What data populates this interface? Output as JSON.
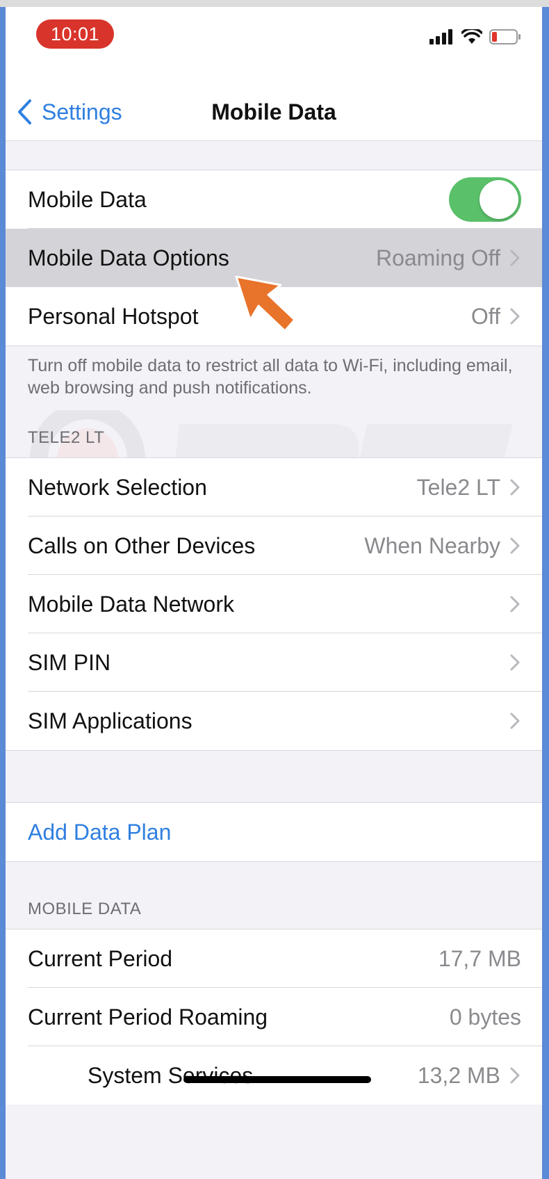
{
  "status_bar": {
    "time": "10:01"
  },
  "nav": {
    "back_label": "Settings",
    "title": "Mobile Data"
  },
  "main_group": {
    "mobile_data_label": "Mobile Data",
    "mobile_data_on": true,
    "options_label": "Mobile Data Options",
    "options_value": "Roaming Off",
    "hotspot_label": "Personal Hotspot",
    "hotspot_value": "Off"
  },
  "footer_note": "Turn off mobile data to restrict all data to Wi-Fi, including email, web browsing and push notifications.",
  "carrier_section": {
    "header": "TELE2 LT",
    "rows": [
      {
        "label": "Network Selection",
        "value": "Tele2 LT"
      },
      {
        "label": "Calls on Other Devices",
        "value": "When Nearby"
      },
      {
        "label": "Mobile Data Network",
        "value": ""
      },
      {
        "label": "SIM PIN",
        "value": ""
      },
      {
        "label": "SIM Applications",
        "value": ""
      }
    ]
  },
  "add_plan": {
    "label": "Add Data Plan"
  },
  "usage_section": {
    "header": "MOBILE DATA",
    "rows": [
      {
        "label": "Current Period",
        "value": "17,7 MB"
      },
      {
        "label": "Current Period Roaming",
        "value": "0 bytes"
      },
      {
        "label": "System Services",
        "value": "13,2 MB"
      }
    ]
  },
  "colors": {
    "accent": "#2f7fe0",
    "toggle_on": "#5ac06a",
    "time_pill": "#d9342b",
    "annotation_arrow": "#e8732a"
  },
  "icons": [
    "chevron-left-icon",
    "signal-icon",
    "wifi-icon",
    "battery-icon",
    "chevron-right-icon",
    "pointer-arrow-icon"
  ]
}
